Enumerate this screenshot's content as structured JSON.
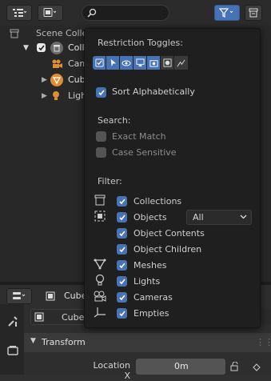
{
  "outliner": {
    "scene_collection": "Scene Colle",
    "rows": [
      "Coll",
      "Cam",
      "Cub",
      "Ligh"
    ]
  },
  "filter_popup": {
    "restriction_heading": "Restriction Toggles:",
    "sort_label": "Sort Alphabetically",
    "search_heading": "Search:",
    "exact_match": "Exact Match",
    "case_sensitive": "Case Sensitive",
    "filter_heading": "Filter:",
    "filters": {
      "collections": "Collections",
      "objects": "Objects",
      "object_contents": "Object Contents",
      "object_children": "Object Children",
      "meshes": "Meshes",
      "lights": "Lights",
      "cameras": "Cameras",
      "empties": "Empties"
    },
    "objects_select": "All"
  },
  "properties": {
    "context_object": "Cube",
    "object_name_field": "Cube",
    "transform_panel": "Transform",
    "location_x_label": "Location X",
    "location_x_value": "0m"
  },
  "colors": {
    "accent": "#4772b3",
    "popup_bg": "#1f1f1f",
    "panel_bg": "#303030"
  },
  "icons": [
    "editor-type-icon",
    "display-mode-icon",
    "search-icon",
    "filter-icon",
    "new-collection-icon",
    "camera-icon",
    "mesh-icon",
    "light-icon",
    "eye-icon",
    "tool-icon",
    "render-icon"
  ]
}
